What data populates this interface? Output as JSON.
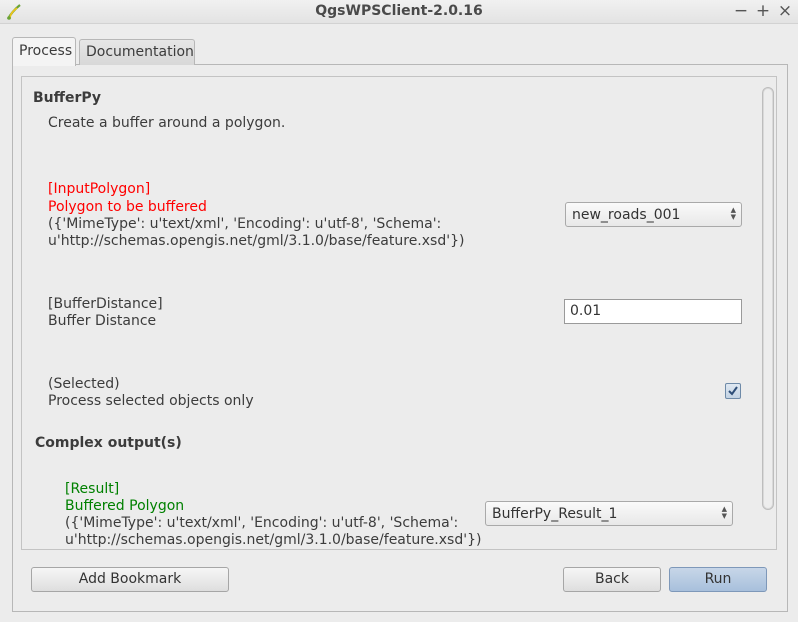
{
  "window": {
    "title": "QgsWPSClient-2.0.16"
  },
  "tabs": [
    {
      "label": "Process"
    },
    {
      "label": "Documentation"
    }
  ],
  "process": {
    "name": "BufferPy",
    "description": "Create a buffer around a polygon."
  },
  "inputs": {
    "polygon": {
      "id": "[InputPolygon]",
      "title": "Polygon to be buffered",
      "mime_line1": "({'MimeType': u'text/xml', 'Encoding': u'utf-8', 'Schema':",
      "mime_line2": "u'http://schemas.opengis.net/gml/3.1.0/base/feature.xsd'})",
      "selected_value": "new_roads_001"
    },
    "distance": {
      "id": "[BufferDistance]",
      "title": "Buffer Distance",
      "value": "0.01"
    },
    "selected": {
      "id": "(Selected)",
      "title": "Process selected objects only",
      "checked": true
    }
  },
  "outputs": {
    "heading": "Complex output(s)",
    "result": {
      "id": "[Result]",
      "title": "Buffered Polygon",
      "mime_line1": "({'MimeType': u'text/xml', 'Encoding': u'utf-8', 'Schema':",
      "mime_line2": "u'http://schemas.opengis.net/gml/3.1.0/base/feature.xsd'})",
      "selected_value": "BufferPy_Result_1"
    }
  },
  "buttons": {
    "add_bookmark": "Add Bookmark",
    "back": "Back",
    "run": "Run"
  },
  "colors": {
    "required": "#ff0000",
    "output": "#008000",
    "primary_button": "#a8c0dc"
  }
}
